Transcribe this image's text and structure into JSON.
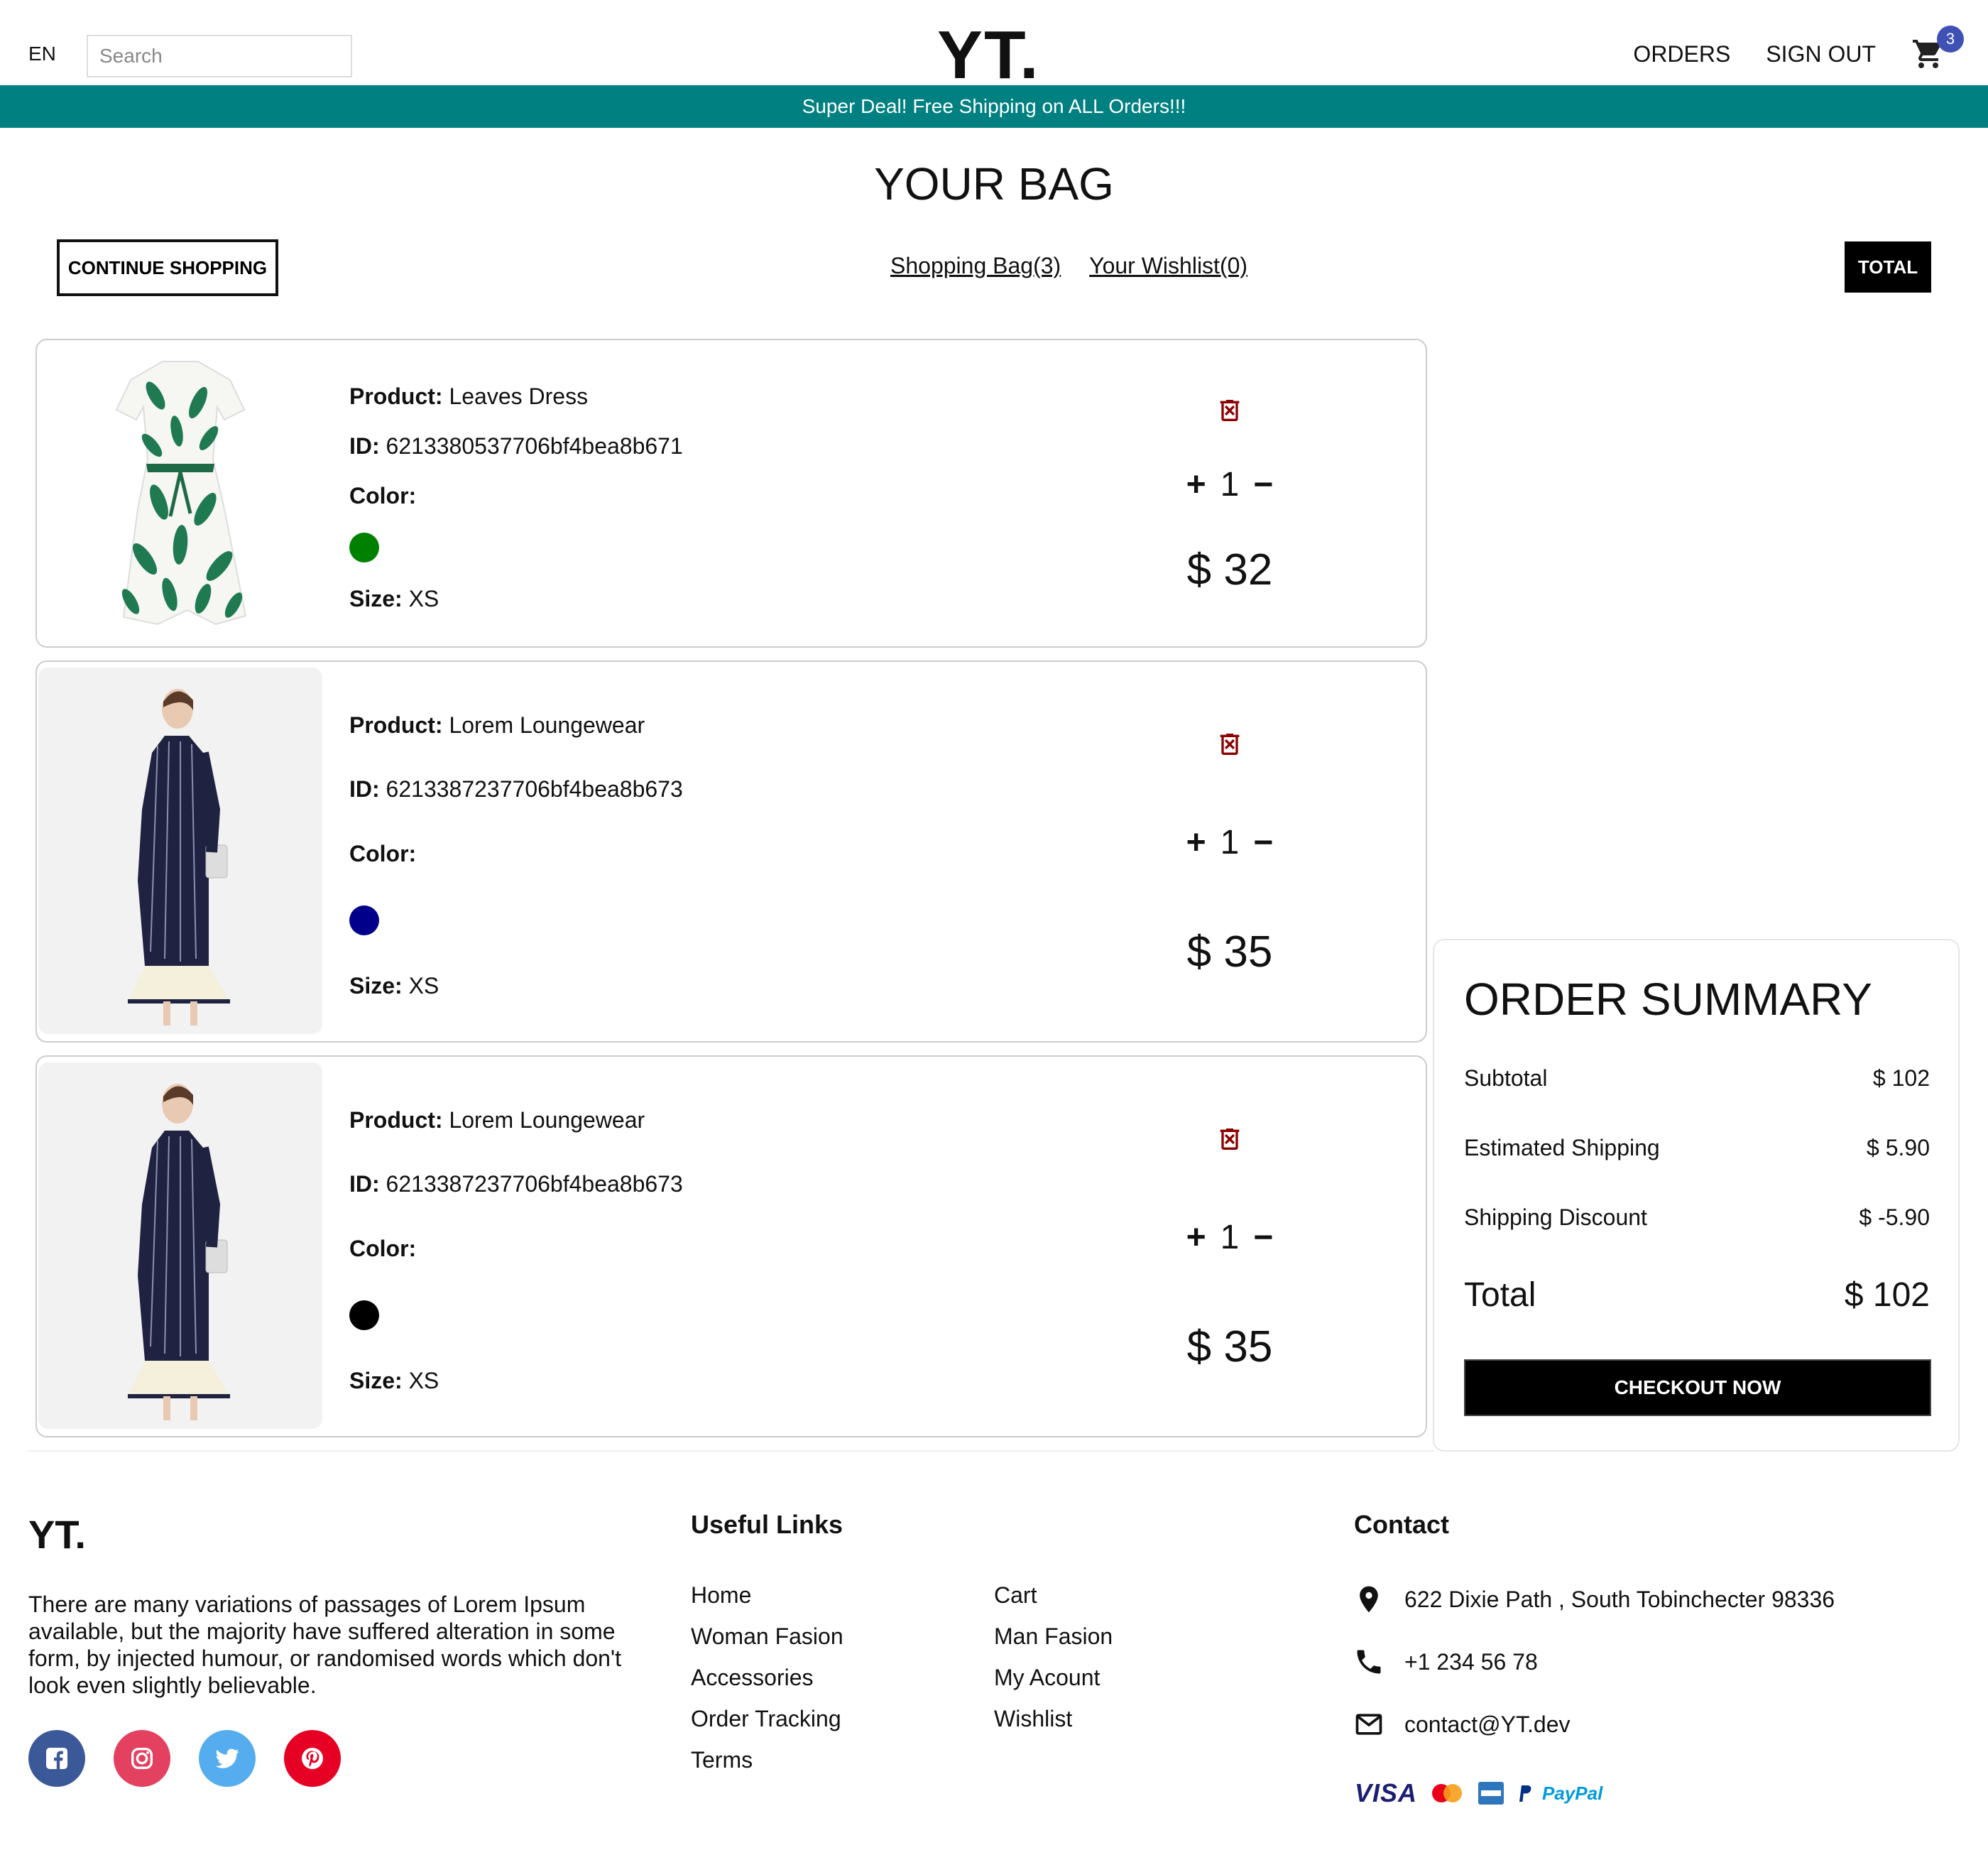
{
  "nav": {
    "lang": "EN",
    "search_placeholder": "Search",
    "logo": "YT.",
    "orders": "ORDERS",
    "sign_out": "SIGN OUT",
    "cart_count": "3"
  },
  "announcement": "Super Deal! Free Shipping on ALL Orders!!!",
  "bag": {
    "title": "YOUR BAG",
    "continue": "CONTINUE SHOPPING",
    "shopping_bag_link": "Shopping Bag(3)",
    "wishlist_link": "Your Wishlist(0)",
    "total_button": "TOTAL"
  },
  "labels": {
    "product": "Product:",
    "id": "ID:",
    "color": "Color:",
    "size": "Size:"
  },
  "products": [
    {
      "name": "Leaves Dress",
      "id": "6213380537706bf4bea8b671",
      "color": "#008000",
      "size": "XS",
      "qty": "1",
      "price": "$ 32",
      "image": "leaves-dress"
    },
    {
      "name": "Lorem Loungewear",
      "id": "6213387237706bf4bea8b673",
      "color": "#00008b",
      "size": "XS",
      "qty": "1",
      "price": "$ 35",
      "image": "loungewear"
    },
    {
      "name": "Lorem Loungewear",
      "id": "6213387237706bf4bea8b673",
      "color": "#000000",
      "size": "XS",
      "qty": "1",
      "price": "$ 35",
      "image": "loungewear"
    }
  ],
  "summary": {
    "title": "ORDER SUMMARY",
    "subtotal_label": "Subtotal",
    "subtotal": "$ 102",
    "shipping_label": "Estimated Shipping",
    "shipping": "$ 5.90",
    "discount_label": "Shipping Discount",
    "discount": "$ -5.90",
    "total_label": "Total",
    "total": "$ 102",
    "checkout": "CHECKOUT NOW"
  },
  "footer": {
    "logo": "YT.",
    "description": "There are many variations of passages of Lorem Ipsum available, but the majority have suffered alteration in some form, by injected humour, or randomised words which don't look even slightly believable.",
    "useful_links_title": "Useful Links",
    "links_col1": [
      "Home",
      "Woman Fasion",
      "Accessories",
      "Order Tracking",
      "Terms"
    ],
    "links_col2": [
      "Cart",
      "Man Fasion",
      "My Acount",
      "Wishlist"
    ],
    "contact_title": "Contact",
    "address": "622 Dixie Path , South Tobinchecter 98336",
    "phone": "+1 234 56 78",
    "email": "contact@YT.dev",
    "social_colors": {
      "facebook": "#3b5999",
      "instagram": "#e4405f",
      "twitter": "#55acee",
      "pinterest": "#e60023"
    },
    "payment_visa": "VISA",
    "payment_paypal": "PayPal"
  }
}
